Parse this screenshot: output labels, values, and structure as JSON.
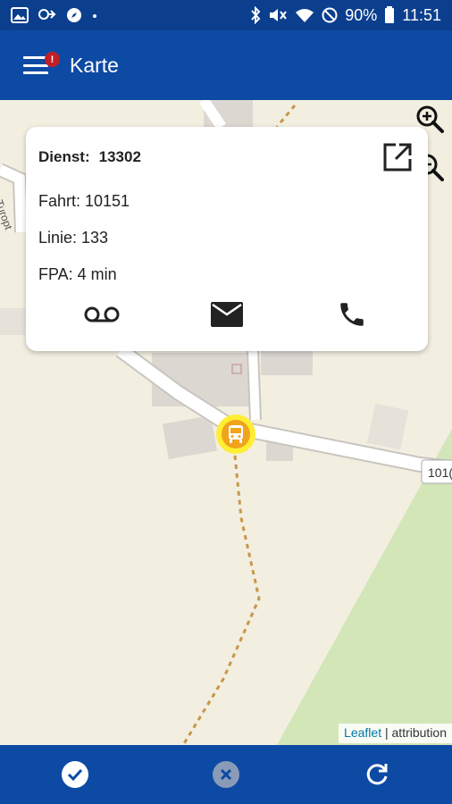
{
  "status_bar": {
    "battery": "90%",
    "time": "11:51",
    "icons": [
      "image-icon",
      "cast-icon",
      "compass-icon",
      "dot-icon",
      "bluetooth-icon",
      "mute-icon",
      "wifi-icon",
      "dnd-icon",
      "battery-icon"
    ]
  },
  "app_bar": {
    "title": "Karte",
    "menu_icon": "hamburger-icon",
    "notification_badge": "!"
  },
  "map": {
    "road_labels": [
      "Turopt",
      "101("
    ],
    "zoom_icons": [
      "zoom-in-icon",
      "zoom-out-icon"
    ],
    "marker_icon": "bus-icon",
    "attribution": {
      "link": "Leaflet",
      "separator": "|",
      "text": "attribution"
    }
  },
  "popup": {
    "dienst_label": "Dienst:",
    "dienst_value": "13302",
    "fahrt": "Fahrt: 10151",
    "linie": "Linie: 133",
    "fpa": "FPA: 4 min",
    "actions": [
      "voicemail-icon",
      "mail-icon",
      "phone-icon"
    ],
    "external_icon": "open-in-new-icon"
  },
  "bottom_bar": {
    "actions": [
      "check-icon",
      "cancel-icon",
      "refresh-icon"
    ]
  },
  "colors": {
    "primary": "#0d4aa4",
    "status_bar": "#0b3f8d",
    "marker_outer": "#ffee33",
    "marker_inner": "#f0a31b",
    "badge": "#c11f25",
    "map_bg": "#f2efe1",
    "green_area": "#d2e6b8"
  }
}
